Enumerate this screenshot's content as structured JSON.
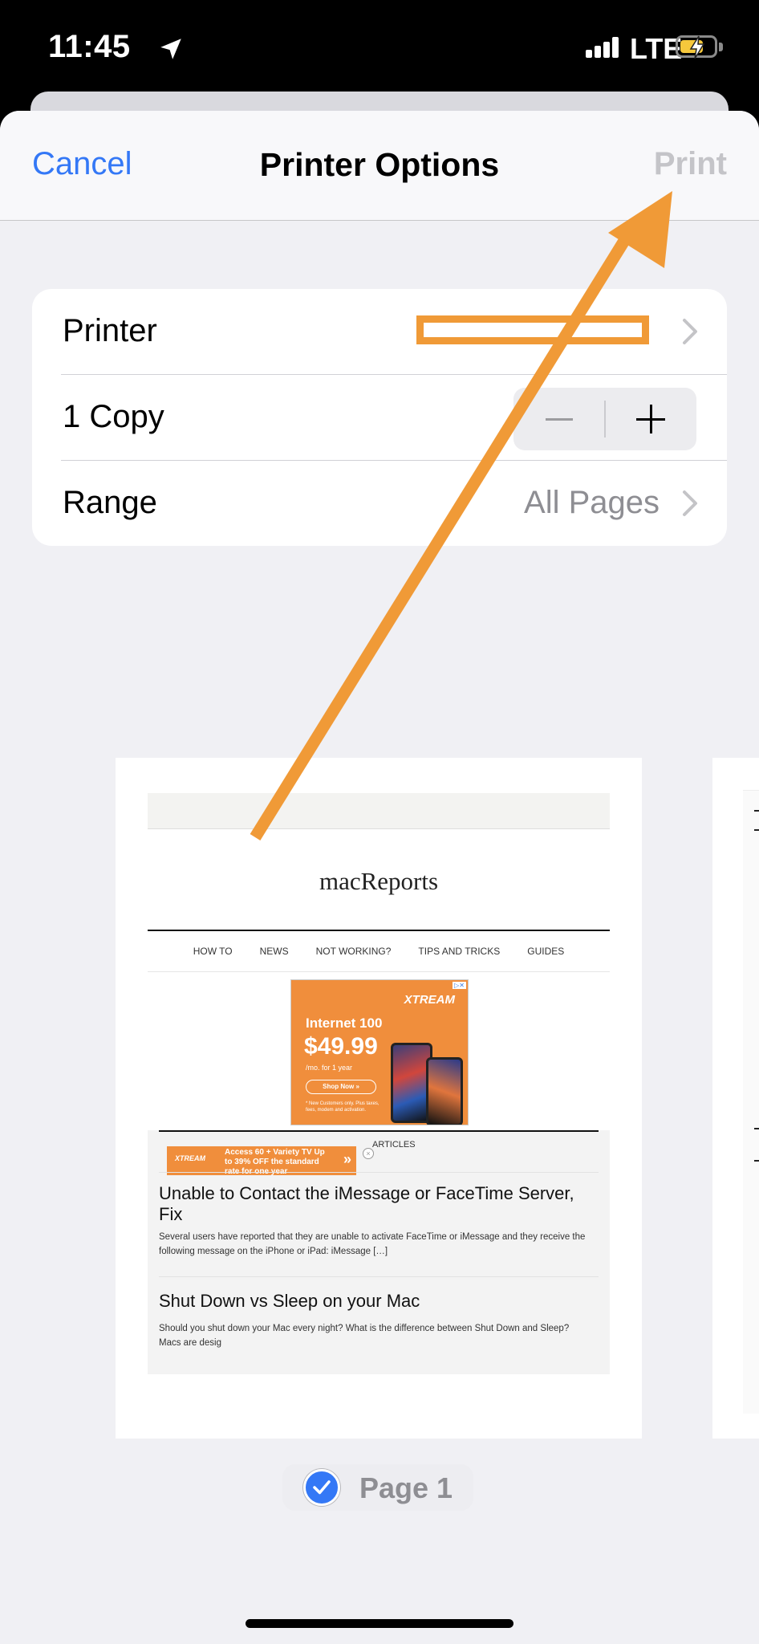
{
  "status_bar": {
    "time": "11:45",
    "network": "LTE",
    "battery_level": 0.7,
    "battery_charging": true
  },
  "nav": {
    "cancel_label": "Cancel",
    "title": "Printer Options",
    "print_label": "Print"
  },
  "options": {
    "printer_label": "Printer",
    "copies_label": "1 Copy",
    "range_label": "Range",
    "range_value": "All Pages"
  },
  "preview": {
    "site_title": "macReports",
    "nav_items": [
      "HOW TO",
      "NEWS",
      "NOT WORKING?",
      "TIPS AND TRICKS",
      "GUIDES"
    ],
    "ad": {
      "brand": "XTREAM",
      "headline": "Internet 100",
      "price": "$49.99",
      "term": "/mo. for 1 year",
      "button": "Shop Now »",
      "fine_print": "* New Customers only. Plus taxes, fees, modem and activation."
    },
    "section_tag": "ARTICLES",
    "float_ad": {
      "brand": "XTREAM",
      "text": "Access 60 + Variety TV Up to 39% OFF the standard rate for one year"
    },
    "articles": [
      {
        "title": "Unable to Contact the iMessage or FaceTime Server, Fix",
        "excerpt": "Several users have reported that they are unable to activate FaceTime or iMessage and they receive the following message on the iPhone or iPad: iMessage […]"
      },
      {
        "title": "Shut Down vs Sleep on your Mac",
        "excerpt": "Should you shut down your Mac every night? What is the difference between Shut Down and Sleep? Macs are desig"
      }
    ],
    "page_label": "Page 1"
  },
  "colors": {
    "accent": "#3478f6",
    "annotation": "#f09a37"
  }
}
